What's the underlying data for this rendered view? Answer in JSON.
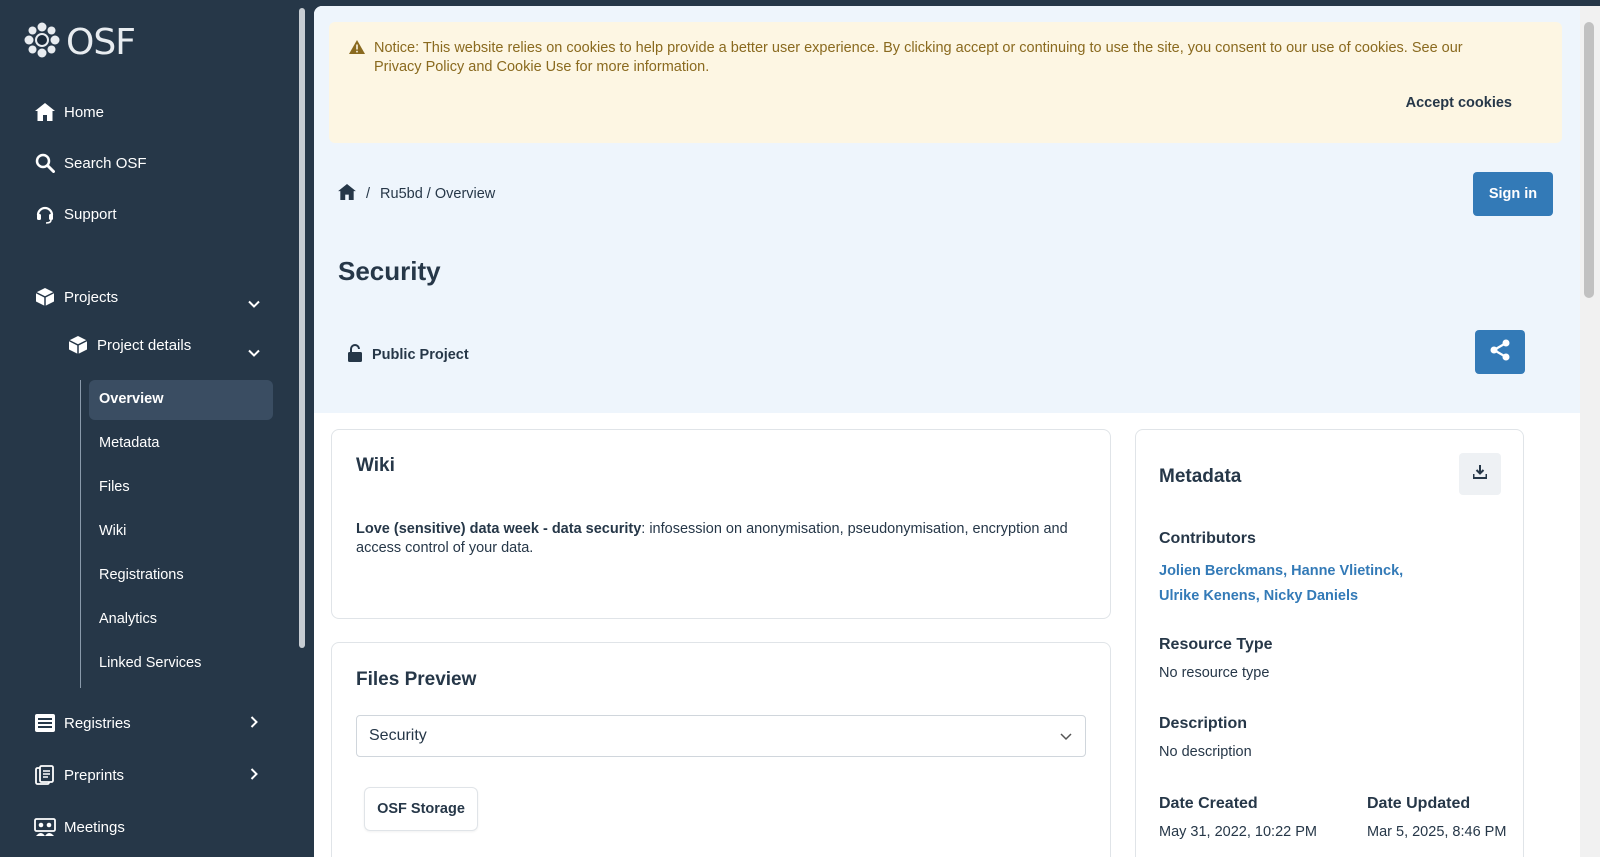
{
  "sidebar": {
    "logo_text": "OSF",
    "nav": {
      "home": "Home",
      "search": "Search OSF",
      "support": "Support",
      "projects": "Projects",
      "project_details": "Project details",
      "registries": "Registries",
      "preprints": "Preprints",
      "meetings": "Meetings"
    },
    "sub_items": [
      "Overview",
      "Metadata",
      "Files",
      "Wiki",
      "Registrations",
      "Analytics",
      "Linked Services"
    ]
  },
  "cookie_notice": {
    "text": "Notice: This website relies on cookies to help provide a better user experience. By clicking accept or continuing to use the site, you consent to our use of cookies. See our Privacy Policy and Cookie Use for more information.",
    "accept_label": "Accept cookies"
  },
  "breadcrumb": {
    "separator": "/",
    "path": "Ru5bd / Overview"
  },
  "header": {
    "sign_in_label": "Sign in",
    "title": "Security",
    "visibility": "Public Project"
  },
  "wiki": {
    "heading": "Wiki",
    "bold_text": "Love (sensitive) data week - data security",
    "text": ": infosession on anonymisation, pseudonymisation, encryption and access control of your data."
  },
  "files_preview": {
    "heading": "Files Preview",
    "selected": "Security",
    "storage_label": "OSF Storage"
  },
  "metadata": {
    "heading": "Metadata",
    "contributors_label": "Contributors",
    "contributors_line1": "Jolien Berckmans, Hanne Vlietinck,",
    "contributors_line2": "Ulrike Kenens, Nicky Daniels",
    "resource_type_label": "Resource Type",
    "resource_type_value": "No resource type",
    "description_label": "Description",
    "description_value": "No description",
    "date_created_label": "Date Created",
    "date_created_value": "May 31, 2022, 10:22 PM",
    "date_updated_label": "Date Updated",
    "date_updated_value": "Mar 5, 2025, 8:46 PM"
  },
  "colors": {
    "sidebar_bg": "#263748",
    "primary_button": "#337ab7",
    "cookie_bg": "#fdf6e3",
    "header_bg": "#eef5fc"
  }
}
